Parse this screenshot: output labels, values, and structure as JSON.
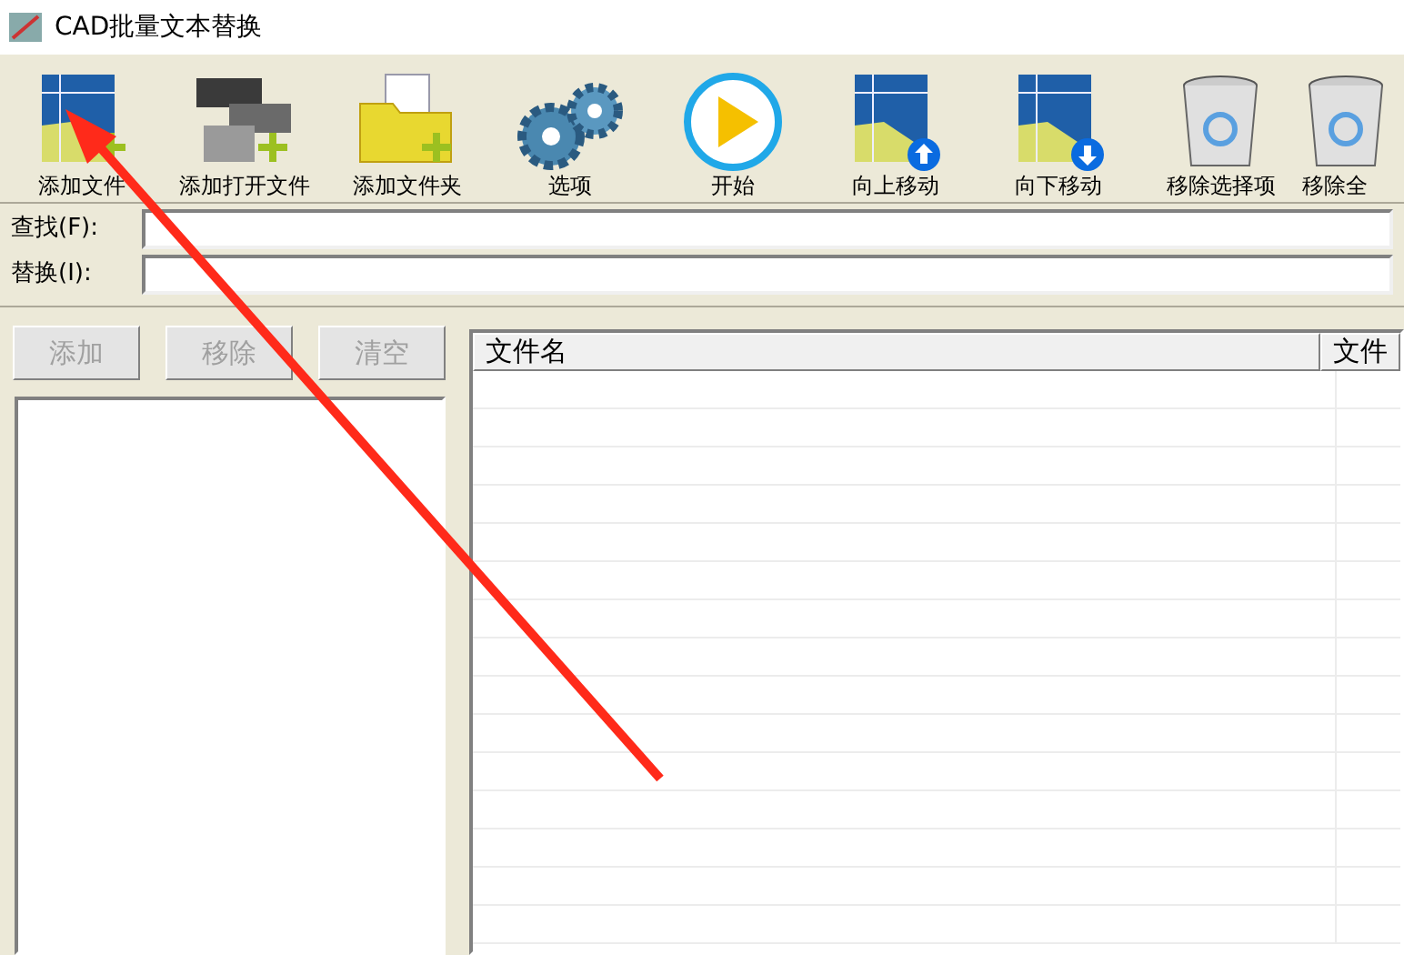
{
  "window": {
    "title": "CAD批量文本替换"
  },
  "toolbar": [
    {
      "kind": "add-file",
      "label": "添加文件"
    },
    {
      "kind": "add-open",
      "label": "添加打开文件"
    },
    {
      "kind": "add-folder",
      "label": "添加文件夹"
    },
    {
      "kind": "options",
      "label": "选项"
    },
    {
      "kind": "start",
      "label": "开始"
    },
    {
      "kind": "move-up",
      "label": "向上移动"
    },
    {
      "kind": "move-down",
      "label": "向下移动"
    },
    {
      "kind": "remove-selected",
      "label": "移除选择项"
    },
    {
      "kind": "remove-all",
      "label": "移除全"
    }
  ],
  "fields": [
    {
      "label": "查找(F):"
    },
    {
      "label": "替换(I):"
    }
  ],
  "list_buttons": [
    {
      "label": "添加",
      "disabled": true
    },
    {
      "label": "移除",
      "disabled": true
    },
    {
      "label": "清空",
      "disabled": true
    }
  ],
  "file_table": {
    "columns": [
      "文件名",
      "文件"
    ]
  }
}
